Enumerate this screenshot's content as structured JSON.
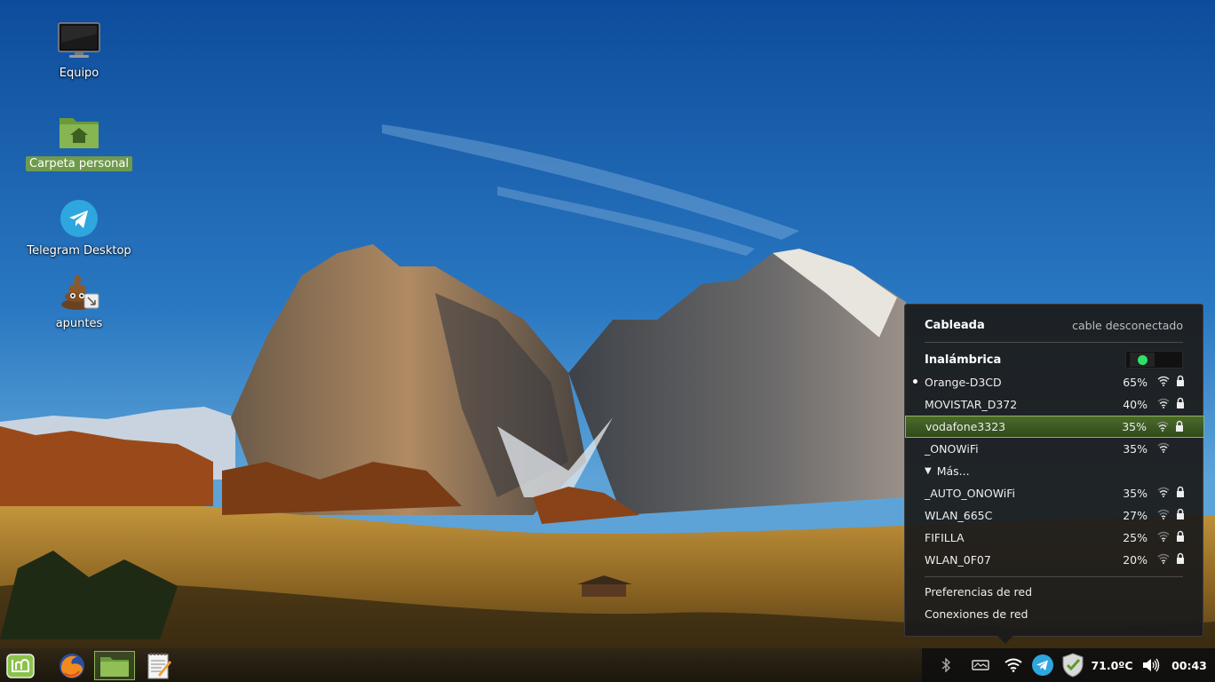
{
  "desktop": {
    "icons": [
      {
        "label": "Equipo"
      },
      {
        "label": "Carpeta personal"
      },
      {
        "label": "Telegram Desktop"
      },
      {
        "label": "apuntes"
      }
    ]
  },
  "network_menu": {
    "wired": {
      "title": "Cableada",
      "status": "cable desconectado"
    },
    "wireless": {
      "title": "Inalámbrica",
      "enabled": true
    },
    "networks": [
      {
        "ssid": "Orange-D3CD",
        "signal": "65%",
        "secured": true,
        "connected": true
      },
      {
        "ssid": "MOVISTAR_D372",
        "signal": "40%",
        "secured": true
      },
      {
        "ssid": "vodafone3323",
        "signal": "35%",
        "secured": true,
        "highlighted": true
      },
      {
        "ssid": "_ONOWiFi",
        "signal": "35%",
        "secured": false
      }
    ],
    "more_label": "Más...",
    "more_networks": [
      {
        "ssid": "_AUTO_ONOWiFi",
        "signal": "35%",
        "secured": true
      },
      {
        "ssid": "WLAN_665C",
        "signal": "27%",
        "secured": true
      },
      {
        "ssid": "FIFILLA",
        "signal": "25%",
        "secured": true
      },
      {
        "ssid": "WLAN_0F07",
        "signal": "20%",
        "secured": true
      }
    ],
    "links": [
      "Preferencias de red",
      "Conexiones de red"
    ]
  },
  "panel": {
    "launchers": [
      "mint-menu-icon",
      "firefox-icon",
      "files-icon",
      "text-editor-icon"
    ],
    "tray": {
      "temperature": "71.0ºC",
      "clock": "00:43"
    }
  },
  "colors": {
    "accent_green": "#8fb65a",
    "toggle_on": "#2ee06a"
  }
}
